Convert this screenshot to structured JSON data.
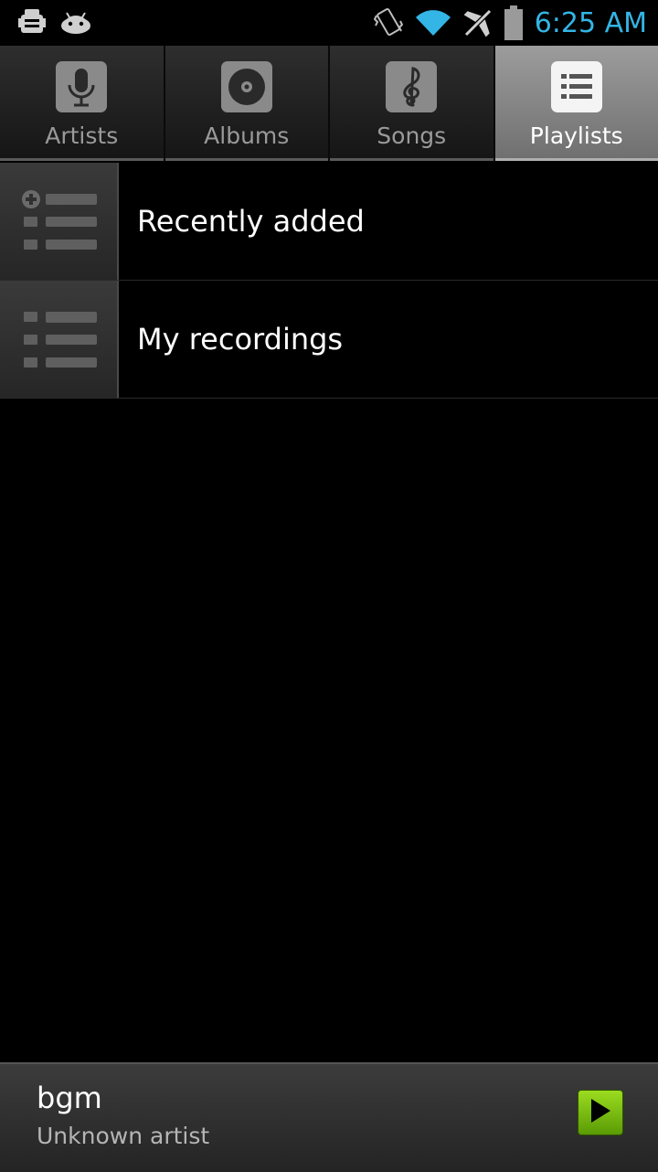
{
  "status_bar": {
    "time": "6:25 AM",
    "icons": [
      "android-debug-icon",
      "android-icon",
      "vibrate-icon",
      "wifi-icon",
      "airplane-mode-icon",
      "battery-icon"
    ]
  },
  "tabs": [
    {
      "label": "Artists",
      "icon": "microphone-icon",
      "active": false
    },
    {
      "label": "Albums",
      "icon": "disc-icon",
      "active": false
    },
    {
      "label": "Songs",
      "icon": "treble-clef-icon",
      "active": false
    },
    {
      "label": "Playlists",
      "icon": "playlist-icon",
      "active": true
    }
  ],
  "playlists": [
    {
      "label": "Recently added",
      "icon": "add-playlist-icon"
    },
    {
      "label": "My recordings",
      "icon": "playlist-icon"
    }
  ],
  "now_playing": {
    "title": "bgm",
    "artist": "Unknown artist",
    "play_icon": "play-icon"
  },
  "colors": {
    "accent_time": "#33b5e5",
    "play_button": "#7cc214",
    "background": "#000000"
  }
}
